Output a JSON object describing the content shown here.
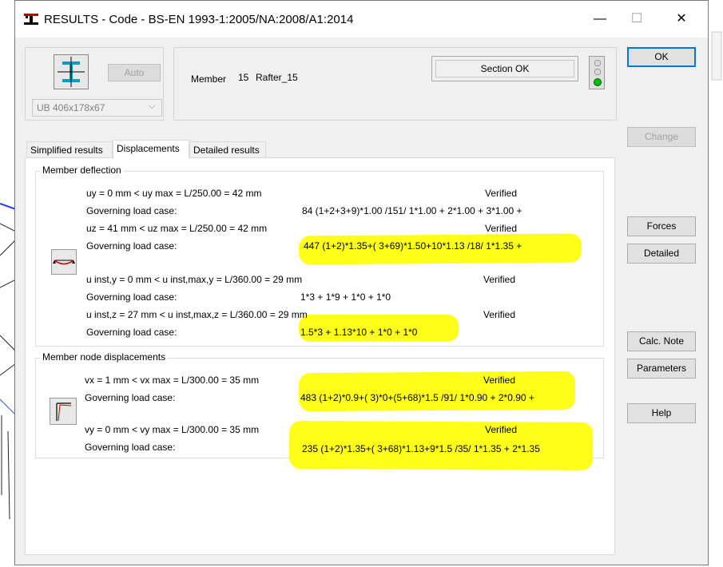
{
  "window": {
    "title": "RESULTS - Code - BS-EN 1993-1:2005/NA:2008/A1:2014",
    "minimize": "—",
    "maximize": "☐",
    "close": "✕"
  },
  "section": {
    "auto_label": "Auto",
    "profile": "UB 406x178x67",
    "member_label": "Member",
    "member_number": "15",
    "member_name": "Rafter_15",
    "status": "Section OK",
    "status_color": "#00c000"
  },
  "buttons": {
    "ok": "OK",
    "change": "Change",
    "forces": "Forces",
    "detailed": "Detailed",
    "calc_note": "Calc. Note",
    "parameters": "Parameters",
    "help": "Help"
  },
  "tabs": [
    "Simplified results",
    "Displacements",
    "Detailed results"
  ],
  "member_deflection": {
    "title": "Member deflection",
    "rows": [
      {
        "text": "uy = 0 mm  <  uy max = L/250.00 = 42 mm",
        "status": "Verified"
      },
      {
        "text": "Governing load case:",
        "value": "84 (1+2+3+9)*1.00 /151/  1*1.00 + 2*1.00 + 3*1.00 +"
      },
      {
        "text": "uz = 41 mm  <  uz max = L/250.00 = 42 mm",
        "status": "Verified"
      },
      {
        "text": "Governing load case:",
        "value": "447 (1+2)*1.35+( 3+69)*1.50+10*1.13 /18/  1*1.35 +"
      },
      {
        "text": "u inst,y = 0 mm  <  u inst,max,y = L/360.00 = 29 mm",
        "status": "Verified"
      },
      {
        "text": "Governing load case:",
        "value": "1*3 + 1*9 + 1*0 + 1*0"
      },
      {
        "text": "u inst,z = 27 mm  <  u inst,max,z = L/360.00 = 29 mm",
        "status": "Verified"
      },
      {
        "text": "Governing load case:",
        "value": "1.5*3 + 1.13*10 + 1*0 + 1*0"
      }
    ]
  },
  "node_displacements": {
    "title": "Member node displacements",
    "rows": [
      {
        "text": "vx = 1 mm  <  vx max = L/300.00 = 35 mm",
        "status": "Verified"
      },
      {
        "text": "Governing load case:",
        "value": "483 (1+2)*0.9+( 3)*0+(5+68)*1.5 /91/  1*0.90 + 2*0.90 +"
      },
      {
        "text": "vy = 0 mm  <  vy max = L/300.00 = 35 mm",
        "status": "Verified"
      },
      {
        "text": "Governing load case:",
        "value": "235 (1+2)*1.35+( 3+68)*1.13+9*1.5 /35/  1*1.35 + 2*1.35"
      }
    ]
  },
  "highlight_color": "#ffff1a"
}
